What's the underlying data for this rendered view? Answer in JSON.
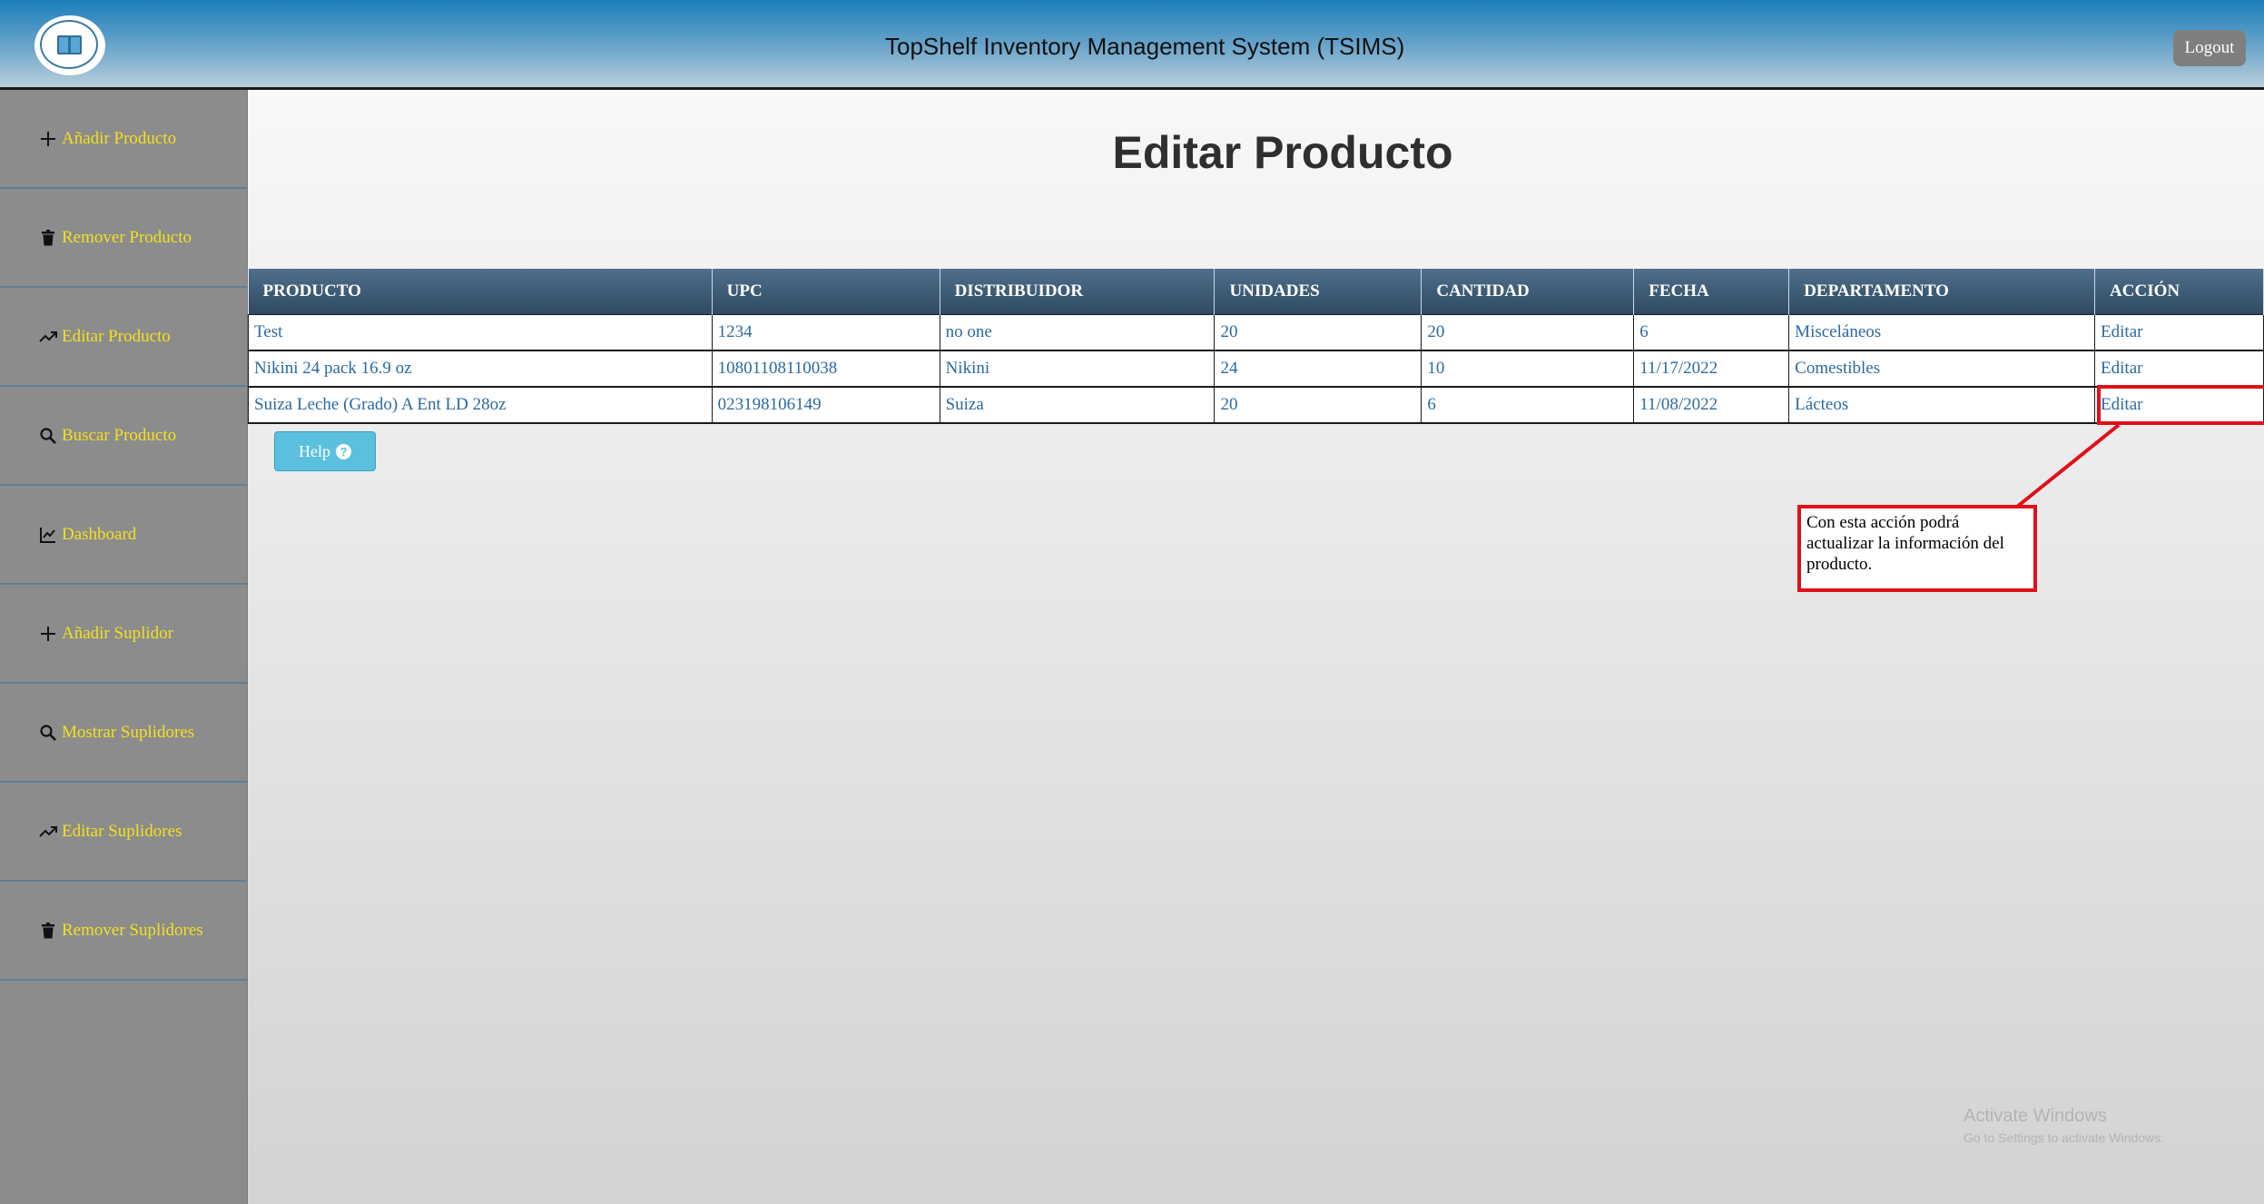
{
  "header": {
    "title": "TopShelf Inventory Management System (TSIMS)",
    "logout_label": "Logout"
  },
  "sidebar": {
    "items": [
      {
        "label": "Añadir Producto",
        "icon": "plus-icon"
      },
      {
        "label": "Remover Producto",
        "icon": "trash-icon"
      },
      {
        "label": "Editar Producto",
        "icon": "trending-up-icon"
      },
      {
        "label": "Buscar Producto",
        "icon": "search-icon"
      },
      {
        "label": "Dashboard",
        "icon": "line-chart-icon"
      },
      {
        "label": "Añadir Suplidor",
        "icon": "plus-icon"
      },
      {
        "label": "Mostrar Suplidores",
        "icon": "search-icon"
      },
      {
        "label": "Editar Suplidores",
        "icon": "trending-up-icon"
      },
      {
        "label": "Remover Suplidores",
        "icon": "trash-icon"
      }
    ]
  },
  "main": {
    "title": "Editar Producto",
    "table": {
      "headers": [
        "PRODUCTO",
        "UPC",
        "DISTRIBUIDOR",
        "UNIDADES",
        "CANTIDAD",
        "FECHA",
        "DEPARTAMENTO",
        "ACCIÓN"
      ],
      "rows": [
        [
          "Test",
          "1234",
          "no one",
          "20",
          "20",
          "6",
          "Misceláneos",
          "Editar"
        ],
        [
          "Nikini 24 pack 16.9 oz",
          "10801108110038",
          "Nikini",
          "24",
          "10",
          "11/17/2022",
          "Comestibles",
          "Editar"
        ],
        [
          "Suiza Leche (Grado) A Ent LD 28oz",
          "023198106149",
          "Suiza",
          "20",
          "6",
          "11/08/2022",
          "Lácteos",
          "Editar"
        ]
      ]
    },
    "help_label": "Help",
    "annotation": "Con esta acción podrá actualizar la información del producto."
  },
  "watermark": {
    "line1": "Activate Windows",
    "line2": "Go to Settings to activate Windows."
  },
  "colors": {
    "sidebar_text": "#f4e01f",
    "link": "#2a6aa0",
    "annotation": "#e0101a",
    "help_button": "#5bc0de"
  }
}
